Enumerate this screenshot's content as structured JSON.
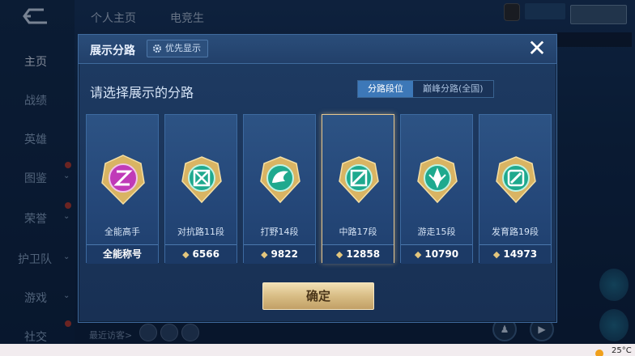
{
  "background": {
    "back_icon": "back-arrow-icon",
    "nav_items": [
      {
        "label": "主页",
        "active": true
      },
      {
        "label": "战绩",
        "active": false
      },
      {
        "label": "英雄",
        "active": false
      },
      {
        "label": "图鉴",
        "active": false
      },
      {
        "label": "荣誉",
        "active": false
      },
      {
        "label": "护卫队",
        "active": false
      },
      {
        "label": "游戏",
        "active": false
      },
      {
        "label": "社交",
        "active": false
      }
    ],
    "top_tabs": [
      "个人主页",
      "电竞生"
    ],
    "recent_label": "最近访客>"
  },
  "modal": {
    "title": "展示分路",
    "priority_label": "优先显示",
    "subtitle": "请选择展示的分路",
    "segments": [
      {
        "label": "分路段位",
        "active": true
      },
      {
        "label": "巅峰分路(全国)",
        "active": false
      }
    ],
    "cards": [
      {
        "label": "全能高手",
        "footer": "全能称号",
        "has_score": false,
        "emblem": "allround-emblem-icon",
        "color": "#c03ab8"
      },
      {
        "label": "对抗路11段",
        "footer": "6566",
        "has_score": true,
        "emblem": "clash-lane-emblem-icon",
        "color": "#1fa98e"
      },
      {
        "label": "打野14段",
        "footer": "9822",
        "has_score": true,
        "emblem": "jungle-emblem-icon",
        "color": "#1fa98e"
      },
      {
        "label": "中路17段",
        "footer": "12858",
        "has_score": true,
        "emblem": "mid-lane-emblem-icon",
        "color": "#1fa98e"
      },
      {
        "label": "游走15段",
        "footer": "10790",
        "has_score": true,
        "emblem": "roam-emblem-icon",
        "color": "#1fa98e"
      },
      {
        "label": "发育路19段",
        "footer": "14973",
        "has_score": true,
        "emblem": "farm-lane-emblem-icon",
        "color": "#1fa98e"
      }
    ],
    "selected_index": 3,
    "confirm_label": "确定",
    "close_icon": "close-icon"
  },
  "taskbar": {
    "temperature": "25°C"
  }
}
